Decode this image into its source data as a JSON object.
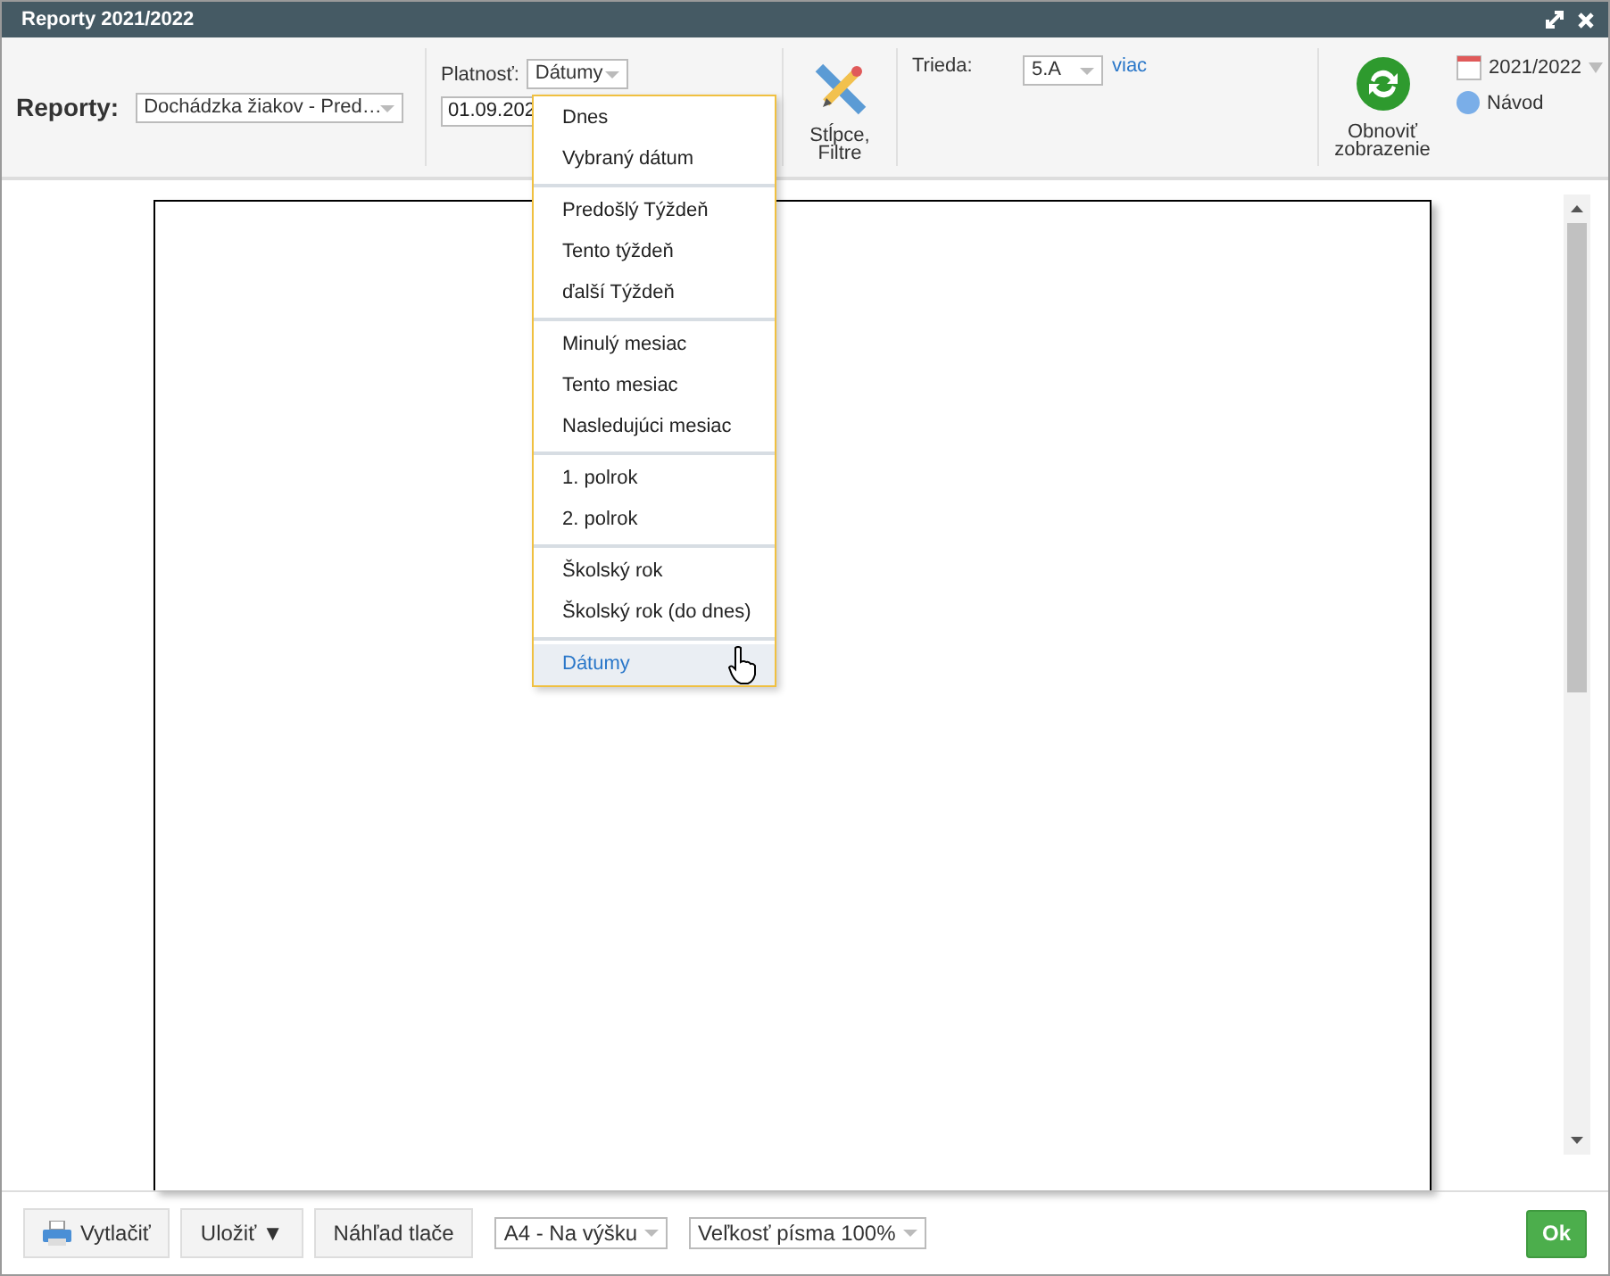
{
  "window": {
    "title": "Reporty 2021/2022"
  },
  "toolbar": {
    "reports_label": "Reporty:",
    "report_select": "Dochádzka žiakov - Pred…",
    "validity_label": "Platnosť:",
    "validity_select": "Dátumy",
    "date_field": "01.09.202",
    "columns_button": "Stĺpce, Filtre",
    "class_label": "Trieda:",
    "class_select": "5.A",
    "more_link": "viac",
    "refresh_button": "Obnoviť zobrazenie",
    "year_select": "2021/2022",
    "help_link": "Návod"
  },
  "menu": {
    "groups": [
      [
        {
          "label": "Dnes",
          "selected": false
        },
        {
          "label": "Vybraný dátum",
          "selected": false
        }
      ],
      [
        {
          "label": "Predošlý Týždeň",
          "selected": false
        },
        {
          "label": "Tento týždeň",
          "selected": false
        },
        {
          "label": "ďalší Týždeň",
          "selected": false
        }
      ],
      [
        {
          "label": "Minulý mesiac",
          "selected": false
        },
        {
          "label": "Tento mesiac",
          "selected": false
        },
        {
          "label": "Nasledujúci mesiac",
          "selected": false
        }
      ],
      [
        {
          "label": "1. polrok",
          "selected": false
        },
        {
          "label": "2. polrok",
          "selected": false
        }
      ],
      [
        {
          "label": "Školský rok",
          "selected": false
        },
        {
          "label": "Školský rok (do dnes)",
          "selected": false
        }
      ],
      [
        {
          "label": "Dátumy",
          "selected": true
        }
      ]
    ]
  },
  "footer": {
    "print_button": "Vytlačiť",
    "save_button": "Uložiť ▼",
    "preview_button": "Náhľad tlače",
    "page_select": "A4 - Na výšku",
    "font_select": "Veľkosť písma 100%",
    "ok_button": "Ok"
  }
}
